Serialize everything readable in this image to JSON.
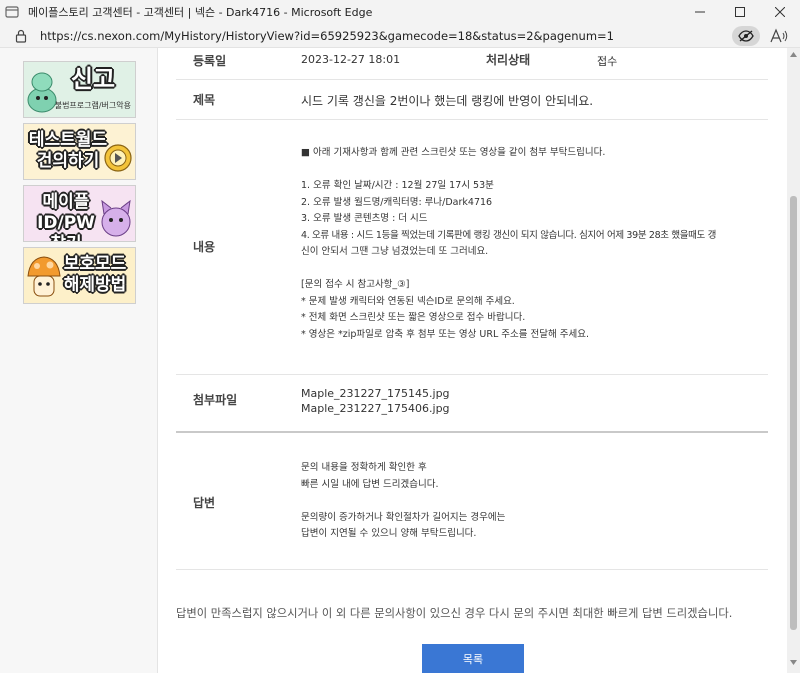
{
  "window": {
    "title": "메이플스토리 고객센터 - 고객센터 | 넥슨 - Dark4716 - Microsoft Edge",
    "url": "https://cs.nexon.com/MyHistory/HistoryView?id=65925923&gamecode=18&status=2&pagenum=1"
  },
  "sidebar": {
    "banners": [
      {
        "title": "신고",
        "sub": "불법프로그램/버그악용",
        "bg": "#e0f1e6"
      },
      {
        "title": "테스트월드 건의하기",
        "sub": "",
        "bg": "#fdf2d3"
      },
      {
        "title": "메이플 ID/PW 찾기",
        "sub": "",
        "bg": "#f6e3f2"
      },
      {
        "title": "보호모드 해제방법",
        "sub": "",
        "bg": "#fdf0c9"
      }
    ]
  },
  "inquiry": {
    "reg_label": "등록일",
    "reg_date": "2023-12-27 18:01",
    "status_label": "처리상태",
    "status_value": "접수",
    "subject_label": "제목",
    "subject": "시드 기록 갱신을 2번이나 했는데 랭킹에 반영이 안되네요.",
    "content_label": "내용",
    "content_lines": [
      "■ 아래 기재사항과 함께 관련 스크린샷 또는 영상을 같이 첨부 부탁드립니다.",
      "",
      "1. 오류 확인 날짜/시간 : 12월 27일 17시 53분",
      "2. 오류 발생 월드명/캐릭터명: 루나/Dark4716",
      "3. 오류 발생 콘텐츠명 : 더 시드",
      "4. 오류 내용 : 시드 1등을 찍었는데 기록판에 랭킹 갱신이 되지 않습니다. 심지어 어제 39분 28초 했을때도 갱",
      "신이 안되서 그땐 그냥 넘겼었는데 또 그러네요.",
      "",
      "[문의 접수 시 참고사항_③]",
      "* 문제 발생 캐릭터와 연동된 넥슨ID로 문의해 주세요.",
      "* 전체 화면 스크린샷 또는 짧은 영상으로 접수 바랍니다.",
      "* 영상은 *zip파일로 압축 후 첨부 또는 영상 URL 주소를 전달해 주세요."
    ],
    "attach_label": "첨부파일",
    "attachments": [
      "Maple_231227_175145.jpg",
      "Maple_231227_175406.jpg"
    ]
  },
  "answer": {
    "label": "답변",
    "lines": [
      "문의 내용을 정확하게 확인한 후",
      "빠른 시일 내에 답변 드리겠습니다.",
      "",
      "문의량이 증가하거나 확인절차가 길어지는 경우에는",
      "답변이 지연될 수 있으니 양해 부탁드립니다."
    ]
  },
  "footer": {
    "notice": "답변이 만족스럽지 않으시거나 이 외 다른 문의사항이 있으신 경우 다시 문의 주시면 최대한 빠르게 답변 드리겠습니다.",
    "list_button": "목록"
  },
  "colors": {
    "accent": "#3a77d4"
  }
}
